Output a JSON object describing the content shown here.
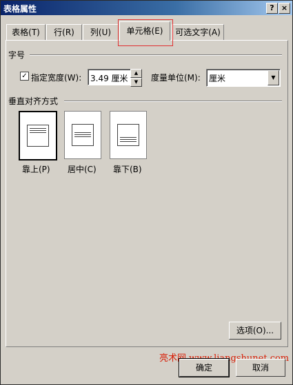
{
  "window": {
    "title": "表格属性",
    "help_label": "?",
    "close_label": "×"
  },
  "tabs": [
    {
      "label": "表格(T)"
    },
    {
      "label": "行(R)"
    },
    {
      "label": "列(U)"
    },
    {
      "label": "单元格(E)",
      "selected": true
    },
    {
      "label": "可选文字(A)"
    }
  ],
  "size_group": {
    "title": "字号",
    "width_checkbox_label": "指定宽度(W):",
    "width_checked": true,
    "width_value": "3.49 厘米",
    "unit_label": "度量单位(M):",
    "unit_value": "厘米"
  },
  "valign_group": {
    "title": "垂直对齐方式",
    "options": [
      {
        "label": "靠上(P)",
        "selected": true
      },
      {
        "label": "居中(C)"
      },
      {
        "label": "靠下(B)"
      }
    ]
  },
  "options_button": "选项(O)...",
  "ok_button": "确定",
  "cancel_button": "取消",
  "watermark": "亮术网 www.liangshunet.com",
  "colors": {
    "title_bar": "#0a246a",
    "dialog_bg": "#d4d0c8",
    "highlight_box": "#e03030",
    "watermark": "#d81e06"
  },
  "icons": {
    "checkbox_mark": "✓",
    "spin_up": "▲",
    "spin_down": "▼",
    "dropdown": "▼"
  }
}
